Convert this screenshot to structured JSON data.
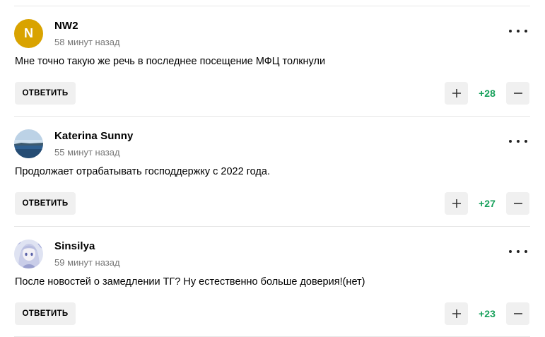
{
  "comments": [
    {
      "author": "NW2",
      "avatar_letter": "N",
      "avatar_color": "#d9a300",
      "time": "58 минут назад",
      "text": "Мне точно такую же речь в последнее посещение МФЦ толкнули",
      "reply_label": "ОТВЕТИТЬ",
      "rating": "+28"
    },
    {
      "author": "Katerina Sunny",
      "avatar_icon": "landscape-photo",
      "time": "55 минут назад",
      "text": "Продолжает отрабатывать господдержку с 2022 года.",
      "reply_label": "ОТВЕТИТЬ",
      "rating": "+27"
    },
    {
      "author": "Sinsilya",
      "avatar_icon": "anime-portrait",
      "time": "59 минут назад",
      "text": "После новостей о замедлении ТГ? Ну естественно больше доверия!(нет)",
      "reply_label": "ОТВЕТИТЬ",
      "rating": "+23"
    }
  ],
  "colors": {
    "positive": "#16a05a",
    "button_bg": "#f0f0f0",
    "meta_text": "#777777"
  }
}
